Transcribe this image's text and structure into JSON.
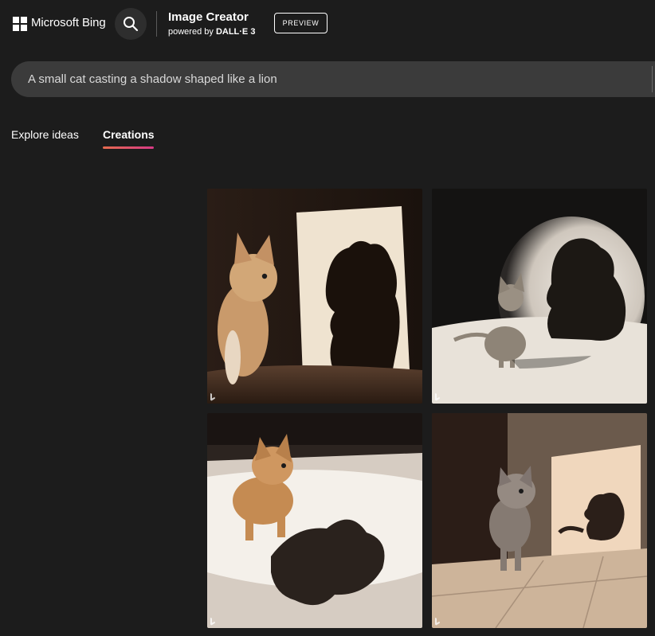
{
  "header": {
    "brand": "Microsoft Bing",
    "app_title": "Image Creator",
    "app_sub_prefix": "powered by",
    "app_sub_model": "DALL·E 3",
    "preview_badge": "PREVIEW"
  },
  "prompt": {
    "value": "A small cat casting a shadow shaped like a lion"
  },
  "tabs": [
    {
      "label": "Explore ideas",
      "active": false
    },
    {
      "label": "Creations",
      "active": true
    }
  ],
  "colors": {
    "background": "#1c1c1c",
    "prompt_bg": "#3b3b3b",
    "tab_underline_start": "#e66b4f",
    "tab_underline_end": "#d73a86"
  },
  "icons": {
    "logo": "microsoft-logo",
    "search": "search-icon",
    "image_mark": "bing-b-icon"
  }
}
